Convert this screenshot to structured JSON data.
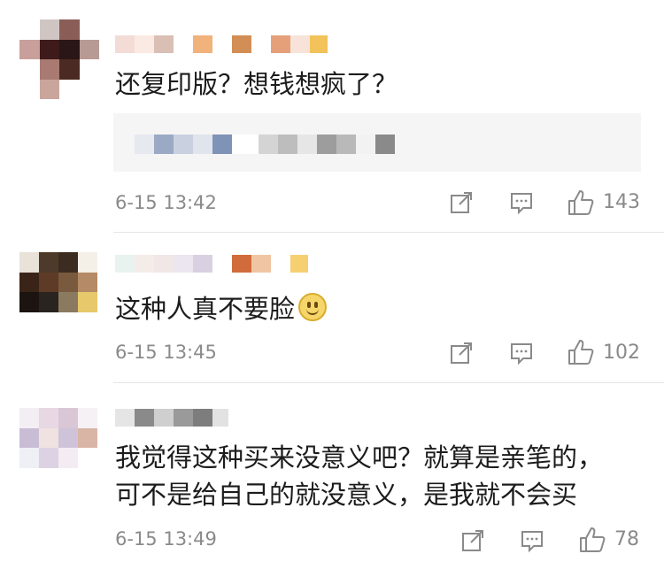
{
  "comments": [
    {
      "text": "还复印版？想钱想疯了？",
      "time": "6-15 13:42",
      "likes": "143"
    },
    {
      "text": "这种人真不要脸",
      "time": "6-15 13:45",
      "likes": "102"
    },
    {
      "text_line1": "我觉得这种买来没意义吧？就算是亲笔的，",
      "text_line2": "可不是给自己的就没意义，是我就不会买",
      "time": "6-15 13:49",
      "likes": "78"
    }
  ],
  "icons": {
    "share": "share-icon",
    "reply": "comment-icon",
    "like": "thumbs-up-icon"
  },
  "colors": {
    "meta_text": "#8a8a8a",
    "quote_background": "#f5f5f5"
  }
}
